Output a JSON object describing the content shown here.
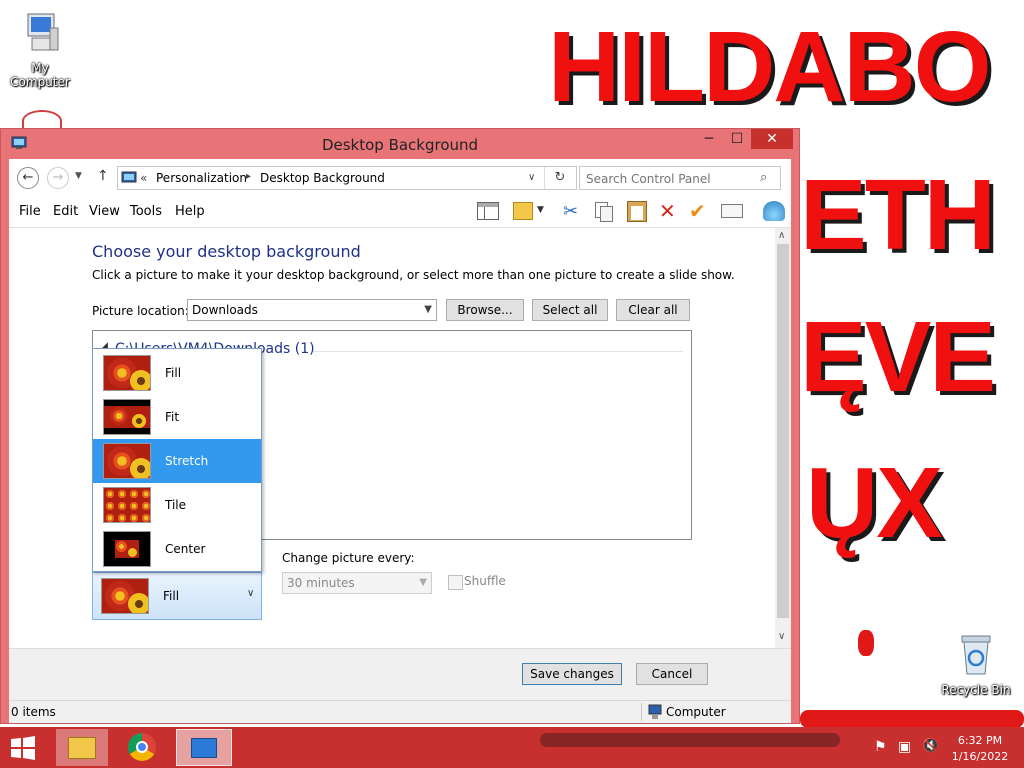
{
  "desktop": {
    "wallpaper_lines": [
      "HILDABO",
      "ETH",
      "ĘVE",
      "ŲX"
    ],
    "icons": [
      {
        "label": "My Computer",
        "icon": "computer-icon"
      },
      {
        "label": "Recycle Bin",
        "icon": "recycle-bin-icon"
      }
    ]
  },
  "window": {
    "title": "Desktop Background",
    "minimize": "─",
    "maximize": "☐",
    "close": "✕"
  },
  "navbar": {
    "back": "←",
    "forward": "→",
    "up": "↑",
    "breadcrumb_prefix": "«",
    "breadcrumb": [
      "Personalization",
      "Desktop Background"
    ],
    "separator": "▸",
    "search_placeholder": "Search Control Panel"
  },
  "menubar": {
    "items": [
      "File",
      "Edit",
      "View",
      "Tools",
      "Help"
    ]
  },
  "main": {
    "heading": "Choose your desktop background",
    "description": "Click a picture to make it your desktop background, or select more than one picture to create a slide show.",
    "picture_location_label": "Picture location:",
    "picture_location_value": "Downloads",
    "browse_label": "Browse...",
    "select_all_label": "Select all",
    "clear_all_label": "Clear all",
    "group_header": "C:\\Users\\VM4\\Downloads (1)",
    "change_picture_label": "Change picture every:",
    "change_picture_value": "30 minutes",
    "shuffle_label": "Shuffle",
    "position_value": "Fill"
  },
  "position_dropdown": {
    "options": [
      "Fill",
      "Fit",
      "Stretch",
      "Tile",
      "Center"
    ],
    "highlighted": "Stretch"
  },
  "footer": {
    "save_label": "Save changes",
    "cancel_label": "Cancel"
  },
  "statusbar": {
    "items_text": "0 items",
    "location_text": "Computer"
  },
  "taskbar": {
    "time": "6:32 PM",
    "date": "1/16/2022"
  },
  "colors": {
    "window_frame": "#e87478",
    "close_button": "#c7312c",
    "highlight": "#3399ee",
    "heading": "#1e3287",
    "wallpaper_text": "#f01010"
  }
}
